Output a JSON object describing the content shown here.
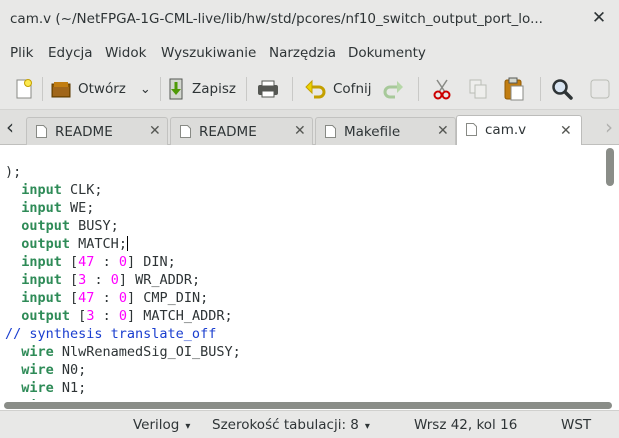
{
  "window": {
    "title": "cam.v (~/NetFPGA-1G-CML-live/lib/hw/std/pcores/nf10_switch_output_port_lo...",
    "close_glyph": "✕"
  },
  "menu": {
    "items": [
      {
        "label": "Plik"
      },
      {
        "label": "Edycja"
      },
      {
        "label": "Widok"
      },
      {
        "label": "Wyszukiwanie"
      },
      {
        "label": "Narzędzia"
      },
      {
        "label": "Dokumenty"
      }
    ]
  },
  "toolbar": {
    "open_label": "Otwórz",
    "save_label": "Zapisz",
    "undo_label": "Cofnij"
  },
  "tabs": [
    {
      "label": "README",
      "active": false
    },
    {
      "label": "README",
      "active": false
    },
    {
      "label": "Makefile",
      "active": false
    },
    {
      "label": "cam.v",
      "active": true
    }
  ],
  "editor": {
    "lines": [
      ");",
      "  input CLK;",
      "  input WE;",
      "  output BUSY;",
      "  output MATCH;",
      "  input [47 : 0] DIN;",
      "  input [3 : 0] WR_ADDR;",
      "  input [47 : 0] CMP_DIN;",
      "  output [3 : 0] MATCH_ADDR;",
      "// synthesis translate_off",
      "  wire NlwRenamedSig_OI_BUSY;",
      "  wire N0;",
      "  wire N1;",
      "  wire \\top_cam/rtl_cam/wren ;"
    ]
  },
  "status": {
    "language": "Verilog",
    "tab_width": "Szerokość tabulacji: 8",
    "position": "Wrsz 42, kol 16",
    "mode": "WST"
  },
  "icons": [
    "new-document-icon",
    "open-folder-icon",
    "save-icon",
    "print-icon",
    "undo-icon",
    "redo-icon",
    "cut-icon",
    "copy-icon",
    "paste-icon",
    "search-icon"
  ]
}
